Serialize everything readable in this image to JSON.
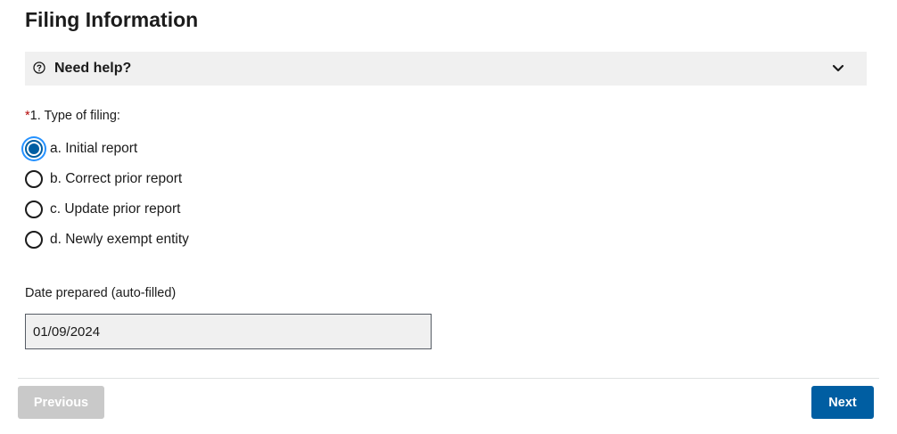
{
  "page": {
    "title": "Filing Information"
  },
  "help": {
    "label": "Need help?",
    "icon": "question-circle-icon",
    "chevron_icon": "chevron-down-icon"
  },
  "question": {
    "required_marker": "*",
    "label": "1. Type of filing:",
    "selected_index": 0,
    "options": [
      {
        "label": "a. Initial report",
        "checked": true
      },
      {
        "label": "b. Correct prior report",
        "checked": false
      },
      {
        "label": "c. Update prior report",
        "checked": false
      },
      {
        "label": "d. Newly exempt entity",
        "checked": false
      }
    ]
  },
  "date_prepared": {
    "label": "Date prepared (auto-filled)",
    "value": "01/09/2024"
  },
  "nav": {
    "previous_label": "Previous",
    "next_label": "Next"
  },
  "colors": {
    "accent": "#005ea2",
    "focus_ring": "#2491ff",
    "required": "#b50909",
    "disabled_button": "#c9c9c9",
    "help_bg": "#f0f0f0"
  }
}
